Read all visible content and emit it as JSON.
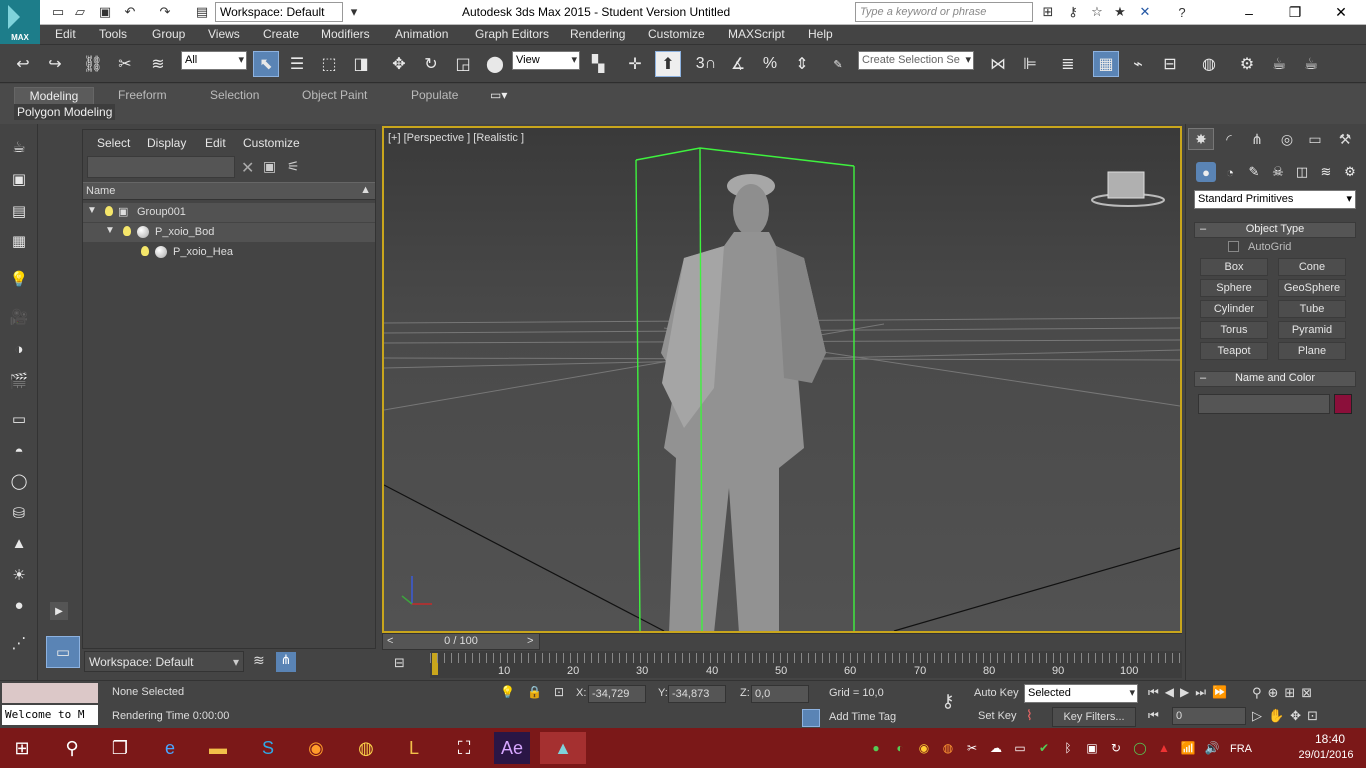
{
  "titlebar": {
    "logo_text": "MAX",
    "workspace": "Workspace: Default",
    "title": "Autodesk 3ds Max  2015   - Student Version    Untitled",
    "search_placeholder": "Type a keyword or phrase"
  },
  "menu": [
    "Edit",
    "Tools",
    "Group",
    "Views",
    "Create",
    "Modifiers",
    "Animation",
    "Graph Editors",
    "Rendering",
    "Customize",
    "MAXScript",
    "Help"
  ],
  "toolbar": {
    "filter_all": "All",
    "ref_coord": "View",
    "snap_3": "3",
    "selection_set_placeholder": "Create Selection Se"
  },
  "ribbon": {
    "tabs": [
      "Modeling",
      "Freeform",
      "Selection",
      "Object Paint",
      "Populate"
    ],
    "active_panel": "Polygon Modeling"
  },
  "explorer": {
    "tabs": [
      "Select",
      "Display",
      "Edit",
      "Customize"
    ],
    "column": "Name",
    "rows": [
      {
        "label": "Group001",
        "level": 0
      },
      {
        "label": "P_xoio_Bod",
        "level": 1
      },
      {
        "label": "P_xoio_Hea",
        "level": 2
      }
    ],
    "workspace": "Workspace: Default"
  },
  "viewport": {
    "label": "[+] [Perspective ] [Realistic ]"
  },
  "timeslider": {
    "value": "0 / 100"
  },
  "timeline": {
    "ticks": [
      "10",
      "20",
      "30",
      "40",
      "50",
      "60",
      "70",
      "80",
      "90",
      "100"
    ]
  },
  "cmdpanel": {
    "dropdown": "Standard Primitives",
    "object_type": "Object Type",
    "autogrid": "AutoGrid",
    "buttons": [
      "Box",
      "Cone",
      "Sphere",
      "GeoSphere",
      "Cylinder",
      "Tube",
      "Torus",
      "Pyramid",
      "Teapot",
      "Plane"
    ],
    "name_and_color": "Name and Color",
    "object_color": "#8b0f3a"
  },
  "status": {
    "maxscript": "Welcome to M",
    "none_selected": "None Selected",
    "rendering_time": "Rendering Time  0:00:00",
    "x_label": "X:",
    "x_val": "-34,729",
    "y_label": "Y:",
    "y_val": "-34,873",
    "z_label": "Z:",
    "z_val": "0,0",
    "grid": "Grid = 10,0",
    "add_time_tag": "Add Time Tag",
    "auto_key": "Auto Key",
    "set_key": "Set Key",
    "selected": "Selected",
    "key_filters": "Key Filters...",
    "frame": "0"
  },
  "taskbar": {
    "lang": "FRA",
    "time": "18:40",
    "date": "29/01/2016"
  }
}
